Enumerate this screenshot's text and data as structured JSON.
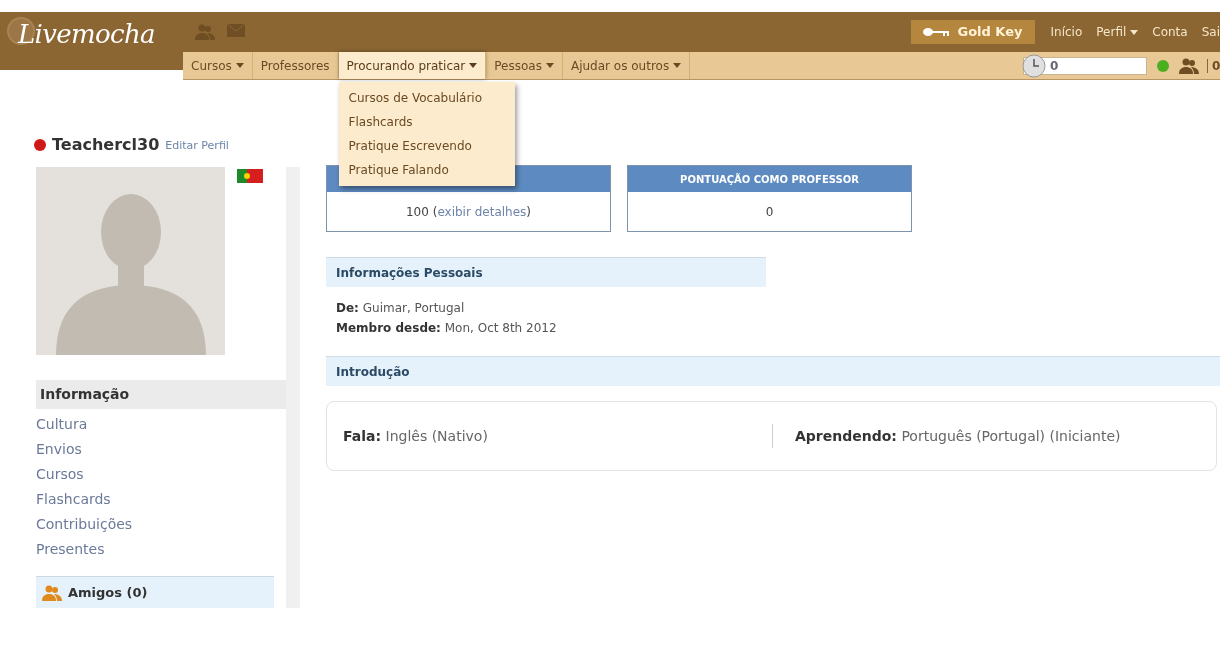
{
  "header": {
    "logo": "Livemocha",
    "gold_key": "Gold Key",
    "links": [
      {
        "label": "Início",
        "has_caret": false
      },
      {
        "label": "Perfil",
        "has_caret": true
      },
      {
        "label": "Conta",
        "has_caret": false
      },
      {
        "label": "Sai",
        "has_caret": false
      }
    ]
  },
  "nav": {
    "items": [
      {
        "label": "Cursos",
        "has_caret": true,
        "selected": false
      },
      {
        "label": "Professores",
        "has_caret": false,
        "selected": false
      },
      {
        "label": "Procurando praticar",
        "has_caret": true,
        "selected": true
      },
      {
        "label": "Pessoas",
        "has_caret": true,
        "selected": false
      },
      {
        "label": "Ajudar os outros",
        "has_caret": true,
        "selected": false
      }
    ],
    "dropdown": [
      "Cursos de Vocabulário",
      "Flashcards",
      "Pratique Escrevendo",
      "Pratique Falando"
    ],
    "points": "0",
    "online": true,
    "friends_count": "0"
  },
  "profile": {
    "username": "Teachercl30",
    "online": false,
    "edit_link": "Editar Perfil"
  },
  "sidebar": {
    "items": [
      {
        "label": "Informação",
        "selected": true
      },
      {
        "label": "Cultura",
        "selected": false
      },
      {
        "label": "Envios",
        "selected": false
      },
      {
        "label": "Cursos",
        "selected": false
      },
      {
        "label": "Flashcards",
        "selected": false
      },
      {
        "label": "Contribuições",
        "selected": false
      },
      {
        "label": "Presentes",
        "selected": false
      }
    ],
    "friends": "Amigos (0)"
  },
  "scores": [
    {
      "value": "100 (",
      "link": "exibir detalhes",
      "suffix": ")"
    },
    {
      "title": "PONTUAÇÃO COMO PROFESSOR",
      "value": "0"
    }
  ],
  "personal_info": {
    "title": "Informações Pessoais",
    "rows": [
      {
        "label": "De:",
        "value": "Guimar, Portugal"
      },
      {
        "label": "Membro desde:",
        "value": "Mon, Oct 8th 2012"
      }
    ]
  },
  "intro": {
    "title": "Introdução",
    "speaks_label": "Fala:",
    "speaks": "Inglês (Nativo)",
    "learning_label": "Aprendendo:",
    "learning": "Português (Portugal) (Iniciante)"
  }
}
